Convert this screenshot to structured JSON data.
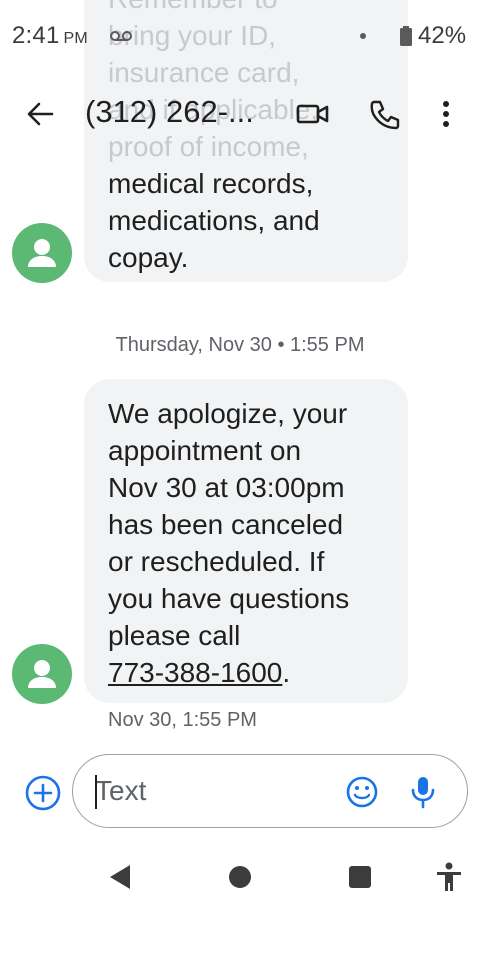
{
  "status_bar": {
    "time": "2:41",
    "ampm": "PM",
    "battery": "42%",
    "icons": [
      "voicemail-icon",
      "dot-icon",
      "battery-icon"
    ]
  },
  "app_bar": {
    "title": "(312) 262-...",
    "icons": [
      "back-arrow-icon",
      "video-call-icon",
      "phone-call-icon",
      "more-vert-icon"
    ]
  },
  "messages": [
    {
      "clipped_text": "Remember to\nbring your ID,\ninsurance card,\nand if applicable,\nproof of income,",
      "text": "medical records,\nmedications, and\ncopay."
    },
    {
      "divider": "Thursday, Nov 30 • 1:55 PM",
      "text": "We apologize, your\nappointment on\nNov 30 at 03:00pm\nhas been canceled\nor rescheduled. If\nyou have questions\nplease call",
      "phone_link": "773-388-1600",
      "after_link": ".",
      "timestamp": "Nov 30, 1:55 PM"
    }
  ],
  "compose": {
    "placeholder": "Text",
    "icons": [
      "add-circle-icon",
      "emoji-icon",
      "mic-icon"
    ]
  },
  "nav_bar": {
    "icons": [
      "nav-back-icon",
      "nav-home-icon",
      "nav-recents-icon",
      "accessibility-icon"
    ]
  },
  "colors": {
    "avatar": "#5bb974",
    "accent": "#1a73e8",
    "bubble": "#f1f3f4"
  }
}
